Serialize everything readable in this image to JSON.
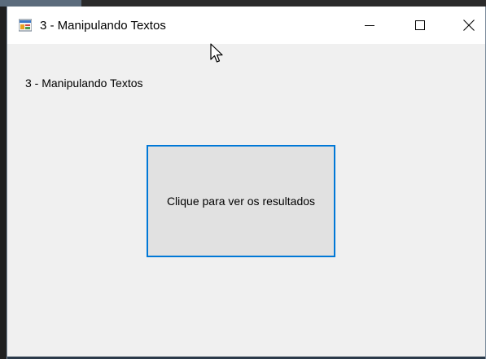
{
  "window": {
    "title": "3 - Manipulando Textos",
    "icon": "winforms-app-icon",
    "controls": {
      "minimize": "minimize-icon",
      "maximize": "maximize-icon",
      "close": "close-icon"
    }
  },
  "form": {
    "label_text": "3 - Manipulando Textos",
    "button_text": "Clique para ver os resultados"
  },
  "colors": {
    "title_bar": "#ffffff",
    "form_background": "#f0f0f0",
    "button_background": "#e1e1e1",
    "button_focus_border": "#0078d7"
  }
}
